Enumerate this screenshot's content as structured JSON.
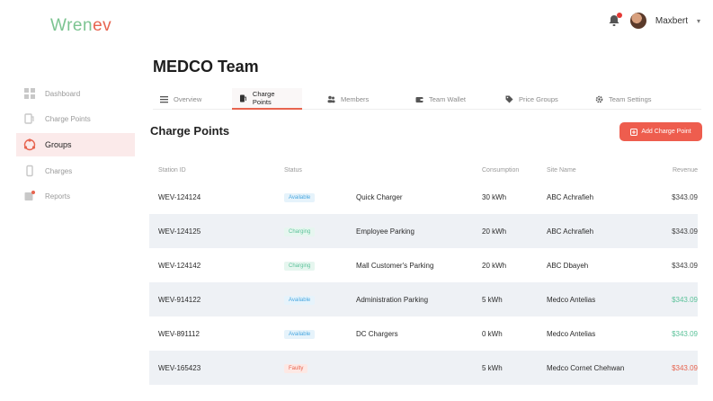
{
  "brand": {
    "logo_part1": "Wren",
    "logo_part2": "ev"
  },
  "user": {
    "name": "Maxbert"
  },
  "sidebar": {
    "items": [
      {
        "label": "Dashboard",
        "icon": "dashboard-icon",
        "active": false
      },
      {
        "label": "Charge Points",
        "icon": "charge-point-icon",
        "active": false
      },
      {
        "label": "Groups",
        "icon": "groups-icon",
        "active": true
      },
      {
        "label": "Charges",
        "icon": "charges-icon",
        "active": false
      },
      {
        "label": "Reports",
        "icon": "reports-icon",
        "active": false
      }
    ]
  },
  "page": {
    "title": "MEDCO Team"
  },
  "tabs": [
    {
      "label": "Overview",
      "icon": "list-icon",
      "active": false
    },
    {
      "label": "Charge Points",
      "icon": "charge-point-icon",
      "active": true
    },
    {
      "label": "Members",
      "icon": "members-icon",
      "active": false
    },
    {
      "label": "Team Wallet",
      "icon": "wallet-icon",
      "active": false
    },
    {
      "label": "Price Groups",
      "icon": "tag-icon",
      "active": false
    },
    {
      "label": "Team Settings",
      "icon": "gear-icon",
      "active": false
    }
  ],
  "section": {
    "title": "Charge Points",
    "add_button": "Add Charge Point"
  },
  "table": {
    "headers": {
      "station_id": "Station ID",
      "status": "Status",
      "name": "",
      "consumption": "Consumption",
      "site_name": "Site Name",
      "revenue": "Revenue"
    },
    "rows": [
      {
        "station_id": "WEV-124124",
        "status": "Available",
        "status_type": "available",
        "name": "Quick Charger",
        "consumption": "30 kWh",
        "site_name": "ABC Achrafieh",
        "revenue": "$343.09",
        "revenue_type": "normal"
      },
      {
        "station_id": "WEV-124125",
        "status": "Charging",
        "status_type": "charging",
        "name": "Employee Parking",
        "consumption": "20 kWh",
        "site_name": "ABC Achrafieh",
        "revenue": "$343.09",
        "revenue_type": "normal"
      },
      {
        "station_id": "WEV-124142",
        "status": "Charging",
        "status_type": "charging",
        "name": "Mall Customer's Parking",
        "consumption": "20 kWh",
        "site_name": "ABC Dbayeh",
        "revenue": "$343.09",
        "revenue_type": "normal"
      },
      {
        "station_id": "WEV-914122",
        "status": "Available",
        "status_type": "available",
        "name": "Administration Parking",
        "consumption": "5 kWh",
        "site_name": "Medco Antelias",
        "revenue": "$343.09",
        "revenue_type": "green"
      },
      {
        "station_id": "WEV-891112",
        "status": "Available",
        "status_type": "available",
        "name": "DC Chargers",
        "consumption": "0 kWh",
        "site_name": "Medco Antelias",
        "revenue": "$343.09",
        "revenue_type": "green"
      },
      {
        "station_id": "WEV-165423",
        "status": "Faulty",
        "status_type": "faulty",
        "name": "",
        "consumption": "5 kWh",
        "site_name": "Medco Cornet Chehwan",
        "revenue": "$343.09",
        "revenue_type": "red"
      }
    ]
  },
  "colors": {
    "accent": "#ee5d4e",
    "brand_green": "#7cc491",
    "available": "#4aa8e0",
    "charging": "#5cc29a",
    "faulty": "#e7644f"
  }
}
